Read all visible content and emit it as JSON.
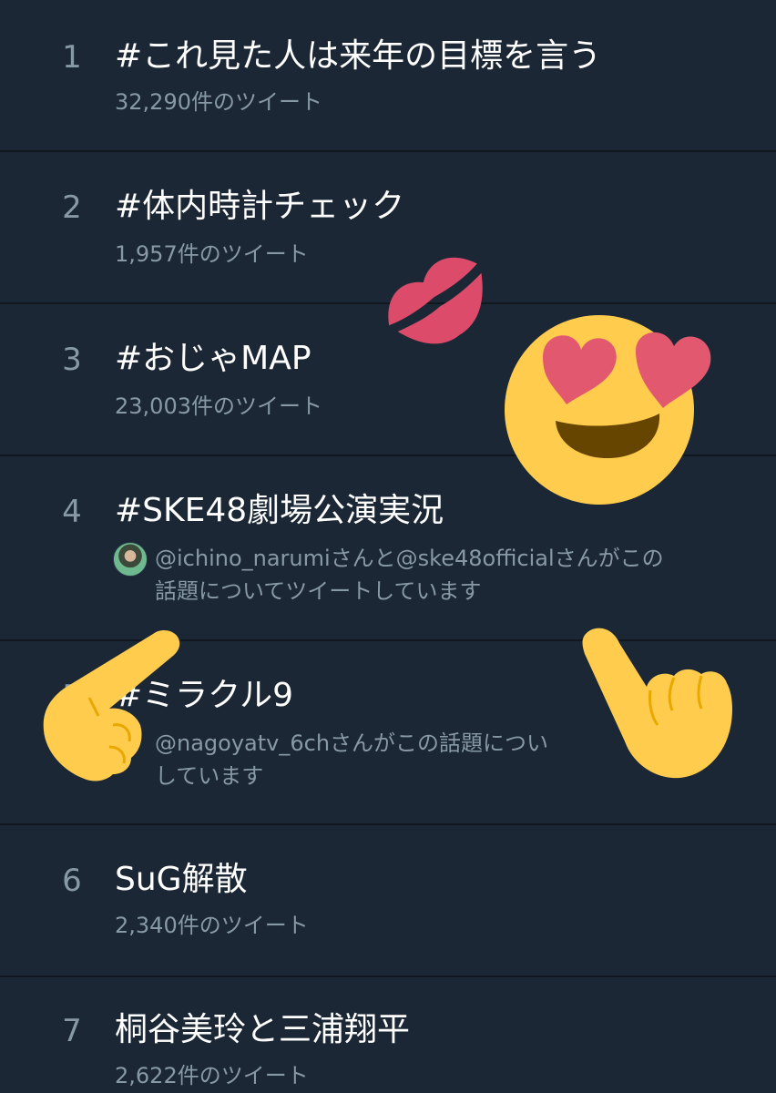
{
  "trends": [
    {
      "rank": "1",
      "title": "#これ見た人は来年の目標を言う",
      "meta": "32,290件のツイート"
    },
    {
      "rank": "2",
      "title": "#体内時計チェック",
      "meta": "1,957件のツイート"
    },
    {
      "rank": "3",
      "title": "#おじゃMAP",
      "meta": "23,003件のツイート"
    },
    {
      "rank": "4",
      "title": "#SKE48劇場公演実況",
      "meta_line1": "@ichino_narumiさんと@ske48officialさんがこの",
      "meta_line2": "話題についてツイートしています"
    },
    {
      "rank": "5",
      "title": "#ミラクル9",
      "meta_line1": "@nagoyatv_6chさんがこの話題につい",
      "meta_line2": "しています"
    },
    {
      "rank": "6",
      "title": "SuG解散",
      "meta": "2,340件のツイート"
    },
    {
      "rank": "7",
      "title": "桐谷美玲と三浦翔平",
      "meta": "2,622件のツイート"
    }
  ],
  "colors": {
    "background": "#1b2735",
    "divider": "#10171e",
    "primary_text": "#ffffff",
    "secondary_text": "#8899a6",
    "emoji_yellow": "#ffcc4d",
    "emoji_red": "#dd2e44"
  },
  "overlays": [
    "kiss-mark-icon",
    "heart-eyes-face-icon",
    "pointing-hand-left-icon",
    "pointing-hand-right-icon"
  ]
}
